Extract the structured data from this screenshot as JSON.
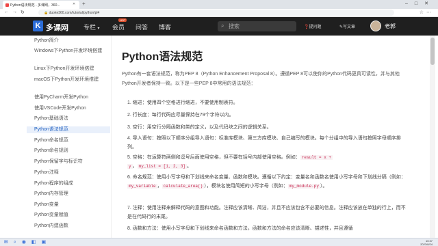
{
  "browser": {
    "tab_title": "Python语法规范 - 多课网，360...",
    "url": "duoke360.com/tutorial/python/pl4"
  },
  "header": {
    "logo_text": "多课网",
    "nav": [
      "专栏",
      "会员",
      "问答",
      "博客"
    ],
    "hot_badge": "HOT",
    "search_placeholder": "搜索",
    "ask_label": "提问题",
    "write_label": "写文章",
    "username": "老郭"
  },
  "sidebar": {
    "items": [
      "Python简介",
      "Windows下Python开发环境搭建",
      "Linux下Python开发环境搭建",
      "macOS下Python开发环境搭建",
      "使用PyCharm开发Python",
      "使用VSCode开发Python",
      "Python基础语法",
      "Python语法规范",
      "Python命名规范",
      "Python命名规则",
      "Python保留字与标识符",
      "Python注释",
      "Python程序的组成",
      "Python内存管理",
      "Python变量",
      "Python变量赋值",
      "Python内建函数"
    ],
    "active_index": 7
  },
  "main": {
    "title": "Python语法规范",
    "intro": "Python有一套语法规范，称为PEP 8（Python Enhancement Proposal 8）。遵循PEP 8可以使你的Python代码更具可读性，并与其他Python开发者保持一致。以下是一些PEP 8中常用的语法规范：",
    "rules": [
      {
        "n": "1.",
        "text": "缩进：使用四个空格进行缩进，不要使用制表符。"
      },
      {
        "n": "2.",
        "text": "行长度：每行代码应尽量保持在79个字符以内。"
      },
      {
        "n": "3.",
        "text": "空行：用空行分隔函数和类的定义，以及代码块之间的逻辑关系。"
      },
      {
        "n": "4.",
        "text": "导入语句：按照以下顺序分组导入语句：标准库模块、第三方库模块、自己编写的模块。每个分组中的导入语句按照字母顺序排列。"
      },
      {
        "n": "5.",
        "text_a": "空格：在运算符两侧和逗号后面使用空格，但不要在括号内部使用空格。例如：",
        "code_a": "result = x +",
        "code_b": "y",
        "text_b": "，",
        "code_c": "my_list = [1, 2, 3]",
        "text_c": "。"
      },
      {
        "n": "6.",
        "text_a": "命名规范：使用小写字母和下划线来命名变量、函数和模块。遵循以下约定：变量名和函数名使用小写字母和下划线分隔（例如：",
        "code_a": "my_variable",
        "text_b": "，",
        "code_b": "calculate_area()",
        "text_c": "），模块名使用简短的小写字母（例如：",
        "code_c": "my_module.py",
        "text_d": "）。"
      },
      {
        "n": "7.",
        "text": "注释：使用注释来解释代码的意图和功能。注释应该清晰、简洁，并且不应该包含不必要的信息。注释应该放在单独的行上，而不是在代码行的末尾。"
      },
      {
        "n": "8.",
        "text": "函数和方法：使用小写字母和下划线来命名函数和方法。函数和方法的命名应该清晰、描述性，并且遵循"
      }
    ]
  },
  "taskbar": {
    "time": "10:37",
    "date": "2023/8/24"
  }
}
